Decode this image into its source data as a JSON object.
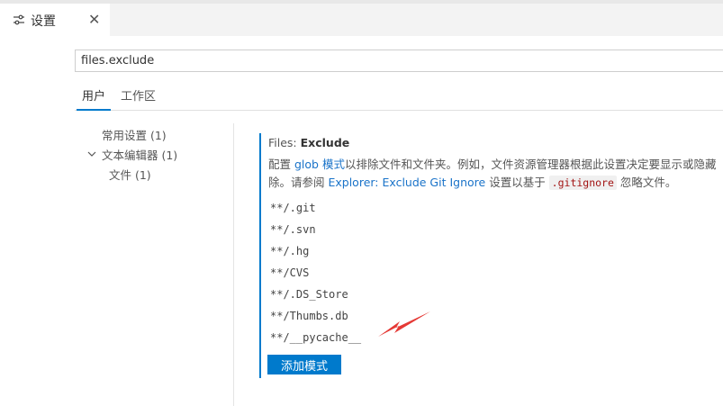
{
  "tab": {
    "title": "设置",
    "icon": "settings-sliders-icon",
    "close": "✕"
  },
  "search": {
    "value": "files.exclude"
  },
  "scopes": [
    {
      "label": "用户",
      "active": true
    },
    {
      "label": "工作区",
      "active": false
    }
  ],
  "toc": {
    "common": "常用设置 (1)",
    "text_editor": "文本编辑器 (1)",
    "files": "文件 (1)"
  },
  "setting": {
    "title_prefix": "Files: ",
    "title_name": "Exclude",
    "desc_line1_a": "配置 ",
    "desc_line1_link": "glob 模式",
    "desc_line1_b": "以排除文件和文件夹。例如，文件资源管理器根据此设置决定要显示或隐藏",
    "desc_line2_a": "除。请参阅 ",
    "desc_line2_link": "Explorer: Exclude Git Ignore",
    "desc_line2_b": " 设置以基于 ",
    "desc_line2_code": ".gitignore",
    "desc_line2_c": " 忽略文件。",
    "patterns": [
      "**/.git",
      "**/.svn",
      "**/.hg",
      "**/CVS",
      "**/.DS_Store",
      "**/Thumbs.db",
      "**/__pycache__"
    ],
    "add_button": "添加模式"
  },
  "colors": {
    "accent": "#007acc",
    "link": "#1a73c9",
    "arrow": "#e53935"
  }
}
